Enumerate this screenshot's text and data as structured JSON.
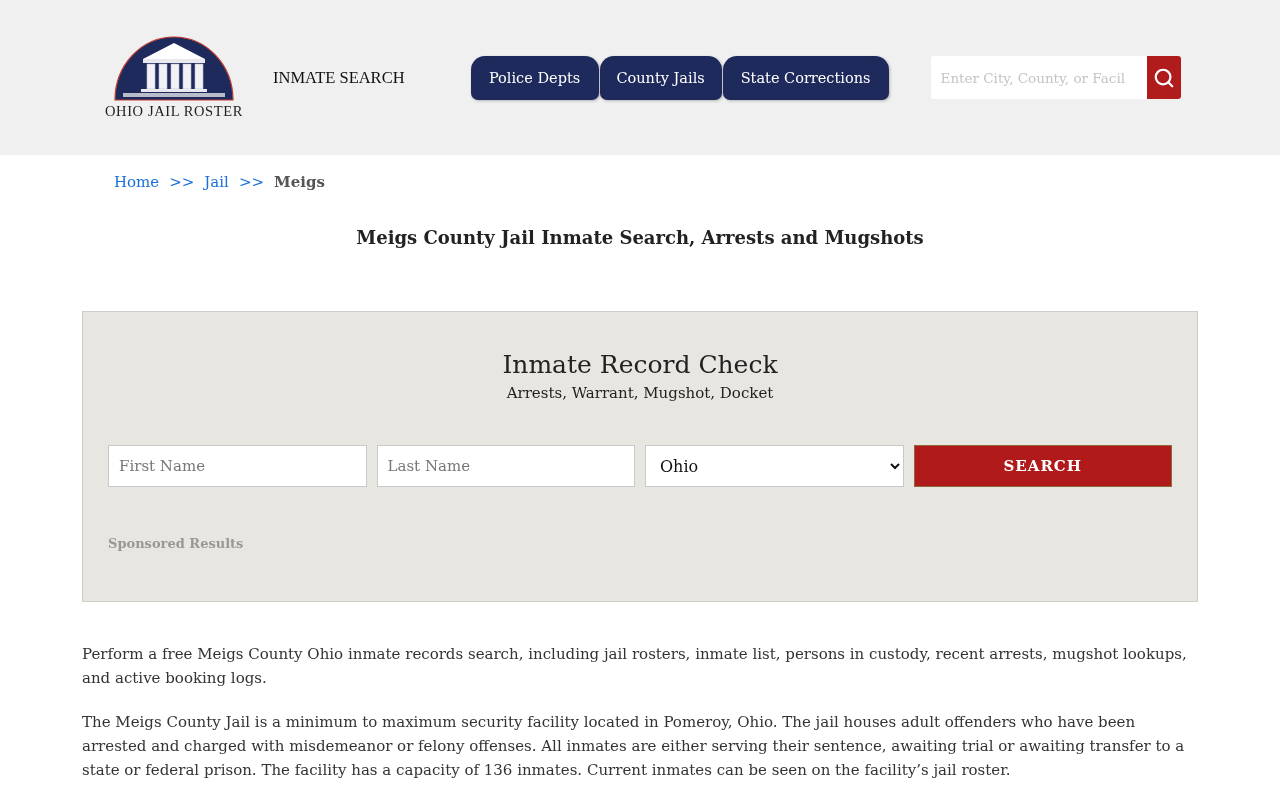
{
  "header": {
    "logo_text": "OHIO JAIL ROSTER",
    "nav_link": "INMATE SEARCH",
    "tabs": [
      {
        "label": "Police Depts"
      },
      {
        "label": "County Jails"
      },
      {
        "label": "State Corrections"
      }
    ],
    "search": {
      "placeholder": "Enter City, County, or Facil"
    }
  },
  "breadcrumb": [
    {
      "kind": "link",
      "label": "Home"
    },
    {
      "kind": "separator",
      "label": ">>"
    },
    {
      "kind": "link",
      "label": "Jail"
    },
    {
      "kind": "separator",
      "label": ">>"
    },
    {
      "kind": "current",
      "label": "Meigs"
    }
  ],
  "title": "Meigs County Jail Inmate Search, Arrests and Mugshots",
  "record_check": {
    "title": "Inmate Record Check",
    "subtitle": "Arrests, Warrant, Mugshot, Docket",
    "fields": [
      {
        "kind": "text",
        "placeholder": "First Name"
      },
      {
        "kind": "text",
        "placeholder": "Last Name"
      },
      {
        "kind": "select",
        "value": "Ohio"
      }
    ],
    "button": "SEARCH",
    "sponsored": "Sponsored Results"
  },
  "paragraphs": [
    "Perform a free Meigs County Ohio inmate records search, including jail rosters, inmate list, persons in custody, recent arrests, mugshot lookups, and active booking logs.",
    "The Meigs County Jail is a minimum to maximum security facility located in Pomeroy, Ohio. The jail houses adult offenders who have been arrested and charged with misdemeanor or felony offenses. All inmates are either serving their sentence, awaiting trial or awaiting transfer to a state or federal prison. The facility has a capacity of 136 inmates. Current inmates can be seen on the facility’s jail roster."
  ]
}
